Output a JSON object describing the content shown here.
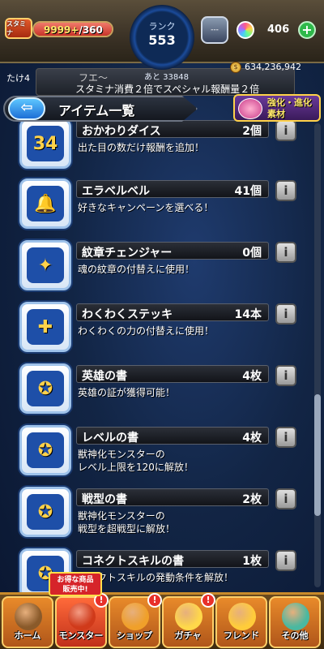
{
  "status": {
    "stamina_label": "スタミナ",
    "stamina_value": "9999+",
    "stamina_max": "/360",
    "stamina_fill": 1.0,
    "rank_label": "ランク",
    "rank_value": "553",
    "rank_next": "あと 33848",
    "lantern_value": "---",
    "orb_count": "406",
    "plus_label": "+",
    "gold_count": "634,236,942",
    "player_name": "たけ4"
  },
  "notice": {
    "label": "フエ〜",
    "text": "スタミナ消費２倍でスペシャル報酬量２倍"
  },
  "header": {
    "back_label": "⇦",
    "title": "アイテム一覧",
    "evo_label_line1": "強化・進化",
    "evo_label_line2": "素材"
  },
  "items": [
    {
      "name": "おかわりダイス",
      "count": "2個",
      "desc": "出た目の数だけ報酬を追加！",
      "icon": "dice-icon",
      "glyph": "34"
    },
    {
      "name": "エラベルベル",
      "count": "41個",
      "desc": "好きなキャンペーンを選べる！",
      "icon": "bell-icon",
      "glyph": "🔔"
    },
    {
      "name": "紋章チェンジャー",
      "count": "0個",
      "desc": "魂の紋章の付替えに使用！",
      "icon": "emblem-changer-icon",
      "glyph": "✦"
    },
    {
      "name": "わくわくステッキ",
      "count": "14本",
      "desc": "わくわくの力の付替えに使用！",
      "icon": "wand-icon",
      "glyph": "✚"
    },
    {
      "name": "英雄の書",
      "count": "4枚",
      "desc": "英雄の証が獲得可能！",
      "icon": "hero-book-icon",
      "glyph": "✪"
    },
    {
      "name": "レベルの書",
      "count": "4枚",
      "desc": "獣神化モンスターの\nレベル上限を120に解放！",
      "icon": "level-book-icon",
      "glyph": "✪"
    },
    {
      "name": "戦型の書",
      "count": "2枚",
      "desc": "獣神化モンスターの\n戦型を超戦型に解放！",
      "icon": "battle-book-icon",
      "glyph": "✪"
    },
    {
      "name": "コネクトスキルの書",
      "count": "1枚",
      "desc": "コネクトスキルの発動条件を解放！",
      "icon": "connect-book-icon",
      "glyph": "✪"
    }
  ],
  "info_label": "i",
  "nav": {
    "sale_tag": "お得な商品\n販売中!",
    "badge": "!",
    "items": [
      {
        "label": "ホーム",
        "icon": "home-icon"
      },
      {
        "label": "モンスター",
        "icon": "monster-icon"
      },
      {
        "label": "ショップ",
        "icon": "shop-icon"
      },
      {
        "label": "ガチャ",
        "icon": "gacha-egg-icon"
      },
      {
        "label": "フレンド",
        "icon": "friend-balloon-icon"
      },
      {
        "label": "その他",
        "icon": "other-menu-icon"
      }
    ]
  }
}
